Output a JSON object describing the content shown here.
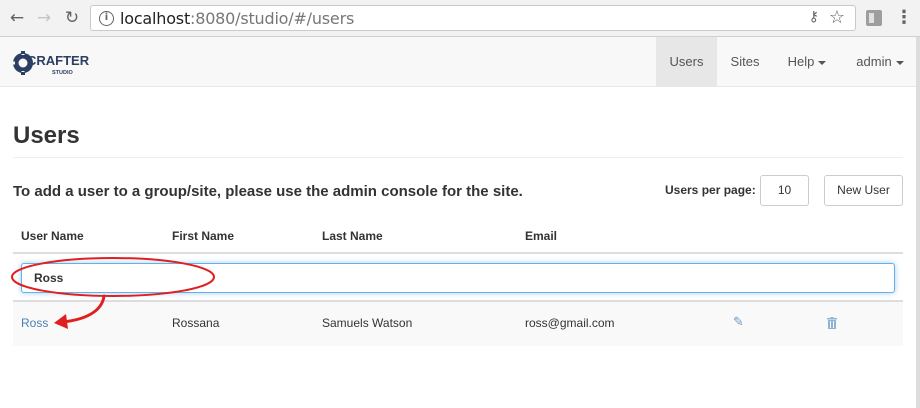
{
  "browser": {
    "url_host": "localhost",
    "url_rest": ":8080/studio/#/users",
    "icons": [
      "back-icon",
      "forward-icon",
      "reload-icon",
      "info-icon",
      "key-icon",
      "star-icon",
      "extension-icon",
      "menu-icon"
    ]
  },
  "navbar": {
    "logo_main": "CRAFTER",
    "logo_sub": "STUDIO",
    "items": [
      {
        "label": "Users",
        "active": true
      },
      {
        "label": "Sites",
        "active": false
      },
      {
        "label": "Help",
        "active": false,
        "dropdown": true
      },
      {
        "label": "admin",
        "active": false,
        "dropdown": true
      }
    ]
  },
  "page": {
    "title": "Users",
    "instructions": "To add a user to a group/site, please use the admin console for the site.",
    "users_per_page_label": "Users per page:",
    "users_per_page_value": "10",
    "new_user_label": "New User"
  },
  "table": {
    "headers": [
      "User Name",
      "First Name",
      "Last Name",
      "Email"
    ],
    "filter_value": "Ross",
    "rows": [
      {
        "username": "Ross",
        "first_name": "Rossana",
        "last_name": "Samuels Watson",
        "email": "ross@gmail.com"
      }
    ]
  },
  "colors": {
    "link": "#4a7fb5",
    "annotation": "#e02020",
    "focus": "#66afe9"
  }
}
